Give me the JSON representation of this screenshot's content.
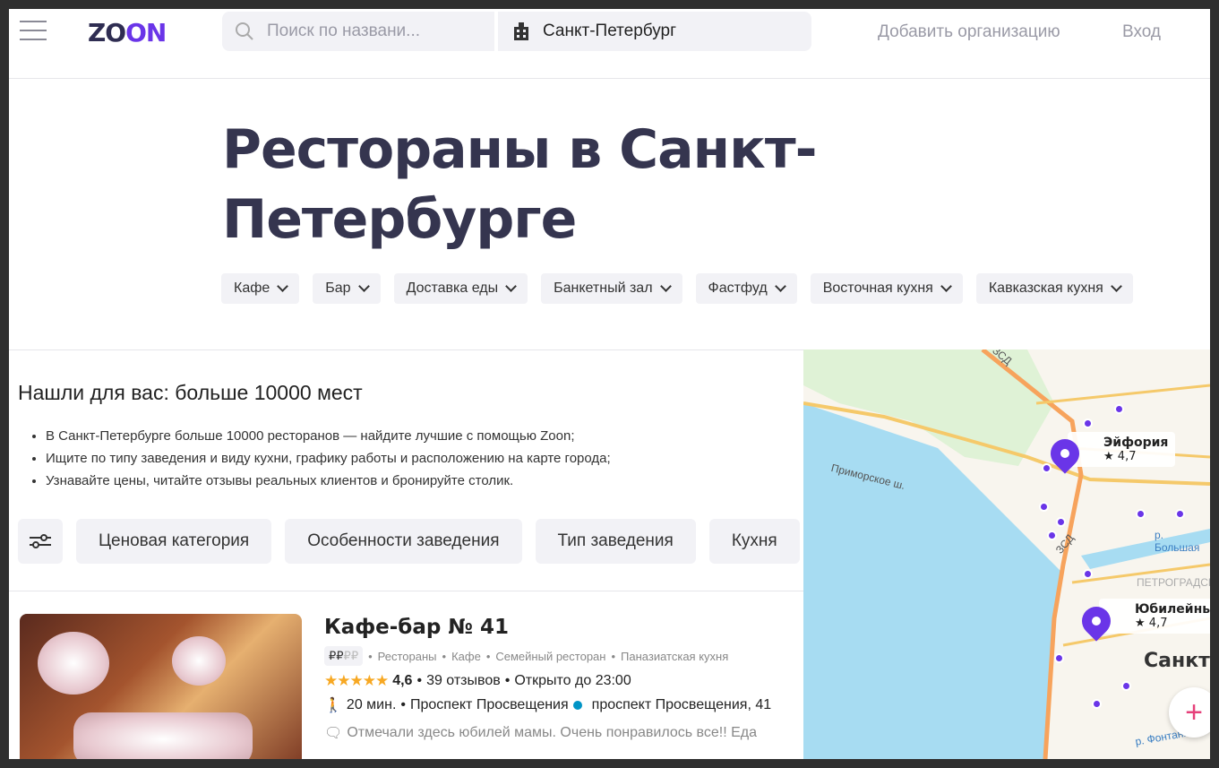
{
  "header": {
    "logo": "ZOON",
    "search_placeholder": "Поиск по названи...",
    "city": "Санкт-Петербург",
    "add_org": "Добавить организацию",
    "login": "Вход"
  },
  "page_title": "Рестораны в Санкт-Петербурге",
  "categories": [
    "Кафе",
    "Бар",
    "Доставка еды",
    "Банкетный зал",
    "Фастфуд",
    "Восточная кухня",
    "Кавказская кухня"
  ],
  "found": "Нашли для вас: больше 10000 мест",
  "bullets": [
    "В Санкт-Петербурге больше 10000 ресторанов — найдите лучшие с помощью Zoon;",
    "Ищите по типу заведения и виду кухни, графику работы и расположению на карте города;",
    "Узнавайте цены, читайте отзывы реальных клиентов и бронируйте столик."
  ],
  "filters": [
    "Ценовая категория",
    "Особенности заведения",
    "Тип заведения",
    "Кухня"
  ],
  "listing": {
    "name": "Кафе-бар № 41",
    "price_active": "₽₽",
    "price_inactive": "₽₽",
    "tags": [
      "Рестораны",
      "Кафе",
      "Семейный ресторан",
      "Паназиатская кухня"
    ],
    "stars": "★★★★★",
    "rating": "4,6",
    "reviews": "39 отзывов",
    "hours": "Открыто до 23:00",
    "walk": "20 мин.",
    "metro": "Проспект Просвещения",
    "address": "проспект Просвещения, 41",
    "review": "Отмечали здесь юбилей мамы. Очень понравилось все!! Еда"
  },
  "map": {
    "places": [
      {
        "name": "Эйфория",
        "rating": "4,7"
      },
      {
        "name": "Юбилейный",
        "rating": "4,7"
      }
    ],
    "labels": [
      "Приморское ш.",
      "ЗСД",
      "ЗСД",
      "р. Большая",
      "ПЕТРОГРАДСКИЙ",
      "Санкт",
      "р. Фонтанка"
    ],
    "zoom_in": "+"
  },
  "colors": {
    "brand": "#6a35e8",
    "star": "#f7a823",
    "metro": "#0094c6"
  }
}
